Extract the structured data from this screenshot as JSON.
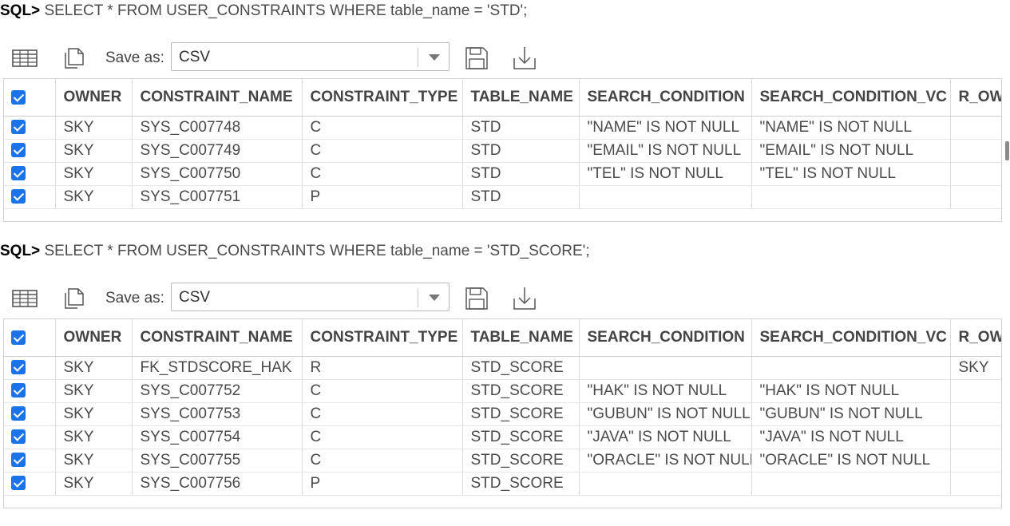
{
  "prompt": "SQL>",
  "toolbar": {
    "save_as_label": "Save as:",
    "format_options": [
      "CSV"
    ],
    "selected_format": "CSV"
  },
  "results": [
    {
      "query": "SELECT * FROM USER_CONSTRAINTS WHERE table_name = 'STD';",
      "columns": [
        "OWNER",
        "CONSTRAINT_NAME",
        "CONSTRAINT_TYPE",
        "TABLE_NAME",
        "SEARCH_CONDITION",
        "SEARCH_CONDITION_VC",
        "R_OWNER"
      ],
      "rows": [
        [
          "SKY",
          "SYS_C007748",
          "C",
          "STD",
          "\"NAME\" IS NOT NULL",
          "\"NAME\" IS NOT NULL",
          ""
        ],
        [
          "SKY",
          "SYS_C007749",
          "C",
          "STD",
          "\"EMAIL\" IS NOT NULL",
          "\"EMAIL\" IS NOT NULL",
          ""
        ],
        [
          "SKY",
          "SYS_C007750",
          "C",
          "STD",
          "\"TEL\" IS NOT NULL",
          "\"TEL\" IS NOT NULL",
          ""
        ],
        [
          "SKY",
          "SYS_C007751",
          "P",
          "STD",
          "",
          "",
          ""
        ]
      ]
    },
    {
      "query": "SELECT * FROM USER_CONSTRAINTS WHERE table_name = 'STD_SCORE';",
      "columns": [
        "OWNER",
        "CONSTRAINT_NAME",
        "CONSTRAINT_TYPE",
        "TABLE_NAME",
        "SEARCH_CONDITION",
        "SEARCH_CONDITION_VC",
        "R_OWNER"
      ],
      "rows": [
        [
          "SKY",
          "FK_STDSCORE_HAK",
          "R",
          "STD_SCORE",
          "",
          "",
          "SKY"
        ],
        [
          "SKY",
          "SYS_C007752",
          "C",
          "STD_SCORE",
          "\"HAK\" IS NOT NULL",
          "\"HAK\" IS NOT NULL",
          ""
        ],
        [
          "SKY",
          "SYS_C007753",
          "C",
          "STD_SCORE",
          "\"GUBUN\" IS NOT NULL",
          "\"GUBUN\" IS NOT NULL",
          ""
        ],
        [
          "SKY",
          "SYS_C007754",
          "C",
          "STD_SCORE",
          "\"JAVA\" IS NOT NULL",
          "\"JAVA\" IS NOT NULL",
          ""
        ],
        [
          "SKY",
          "SYS_C007755",
          "C",
          "STD_SCORE",
          "\"ORACLE\" IS NOT NULL",
          "\"ORACLE\" IS NOT NULL",
          ""
        ],
        [
          "SKY",
          "SYS_C007756",
          "P",
          "STD_SCORE",
          "",
          "",
          ""
        ]
      ]
    }
  ],
  "icons": [
    "grid-view-icon",
    "copy-icon",
    "save-icon",
    "download-icon",
    "chevron-down-icon",
    "checkbox-checked-icon"
  ],
  "colors": {
    "checkbox": "#1a73e8",
    "text": "#4a4a4a",
    "border": "#d2d2d2"
  }
}
